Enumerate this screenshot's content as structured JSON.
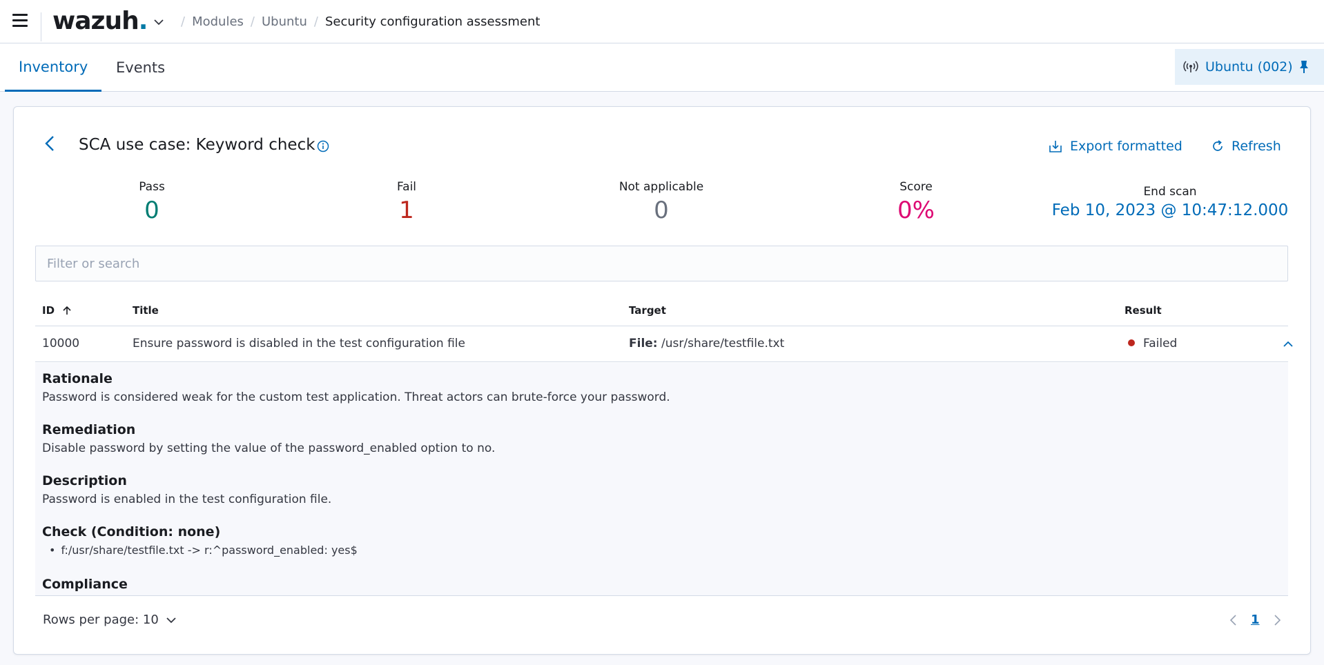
{
  "header": {
    "logo_text": "wazuh",
    "logo_dot": ".",
    "breadcrumbs": [
      "Modules",
      "Ubuntu",
      "Security configuration assessment"
    ]
  },
  "tabs": [
    {
      "label": "Inventory",
      "active": true
    },
    {
      "label": "Events",
      "active": false
    }
  ],
  "agent": {
    "label": "Ubuntu (002)"
  },
  "panel": {
    "title": "SCA use case: Keyword check",
    "export_label": "Export formatted",
    "refresh_label": "Refresh",
    "stats": {
      "pass_label": "Pass",
      "pass_value": "0",
      "fail_label": "Fail",
      "fail_value": "1",
      "na_label": "Not applicable",
      "na_value": "0",
      "score_label": "Score",
      "score_value": "0%",
      "end_scan_label": "End scan",
      "end_scan_value": "Feb 10, 2023 @ 10:47:12.000"
    },
    "search_placeholder": "Filter or search"
  },
  "table": {
    "columns": [
      "ID",
      "Title",
      "Target",
      "Result"
    ],
    "rows": [
      {
        "id": "10000",
        "title": "Ensure password is disabled in the test configuration file",
        "target_label": "File:",
        "target_value": "/usr/share/testfile.txt",
        "result": "Failed"
      }
    ]
  },
  "details": {
    "rationale_h": "Rationale",
    "rationale": "Password is considered weak for the custom test application. Threat actors can brute-force your password.",
    "remediation_h": "Remediation",
    "remediation": "Disable password by setting the value of the password_enabled option to no.",
    "description_h": "Description",
    "description": "Password is enabled in the test configuration file.",
    "check_h": "Check (Condition: none)",
    "check_item": "f:/usr/share/testfile.txt -> r:^password_enabled: yes$",
    "compliance_h": "Compliance"
  },
  "footer": {
    "rows_per_page": "Rows per page: 10",
    "current_page": "1"
  },
  "colors": {
    "accent": "#006bb8",
    "pass": "#017d73",
    "fail": "#bd271e",
    "score": "#dd0a73",
    "na": "#69707d"
  }
}
